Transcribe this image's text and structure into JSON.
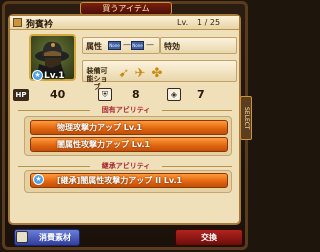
{
  "header": {
    "title": "買うアイテム"
  },
  "item": {
    "name": "狗賓衿",
    "lv_label": "Lv.",
    "lv_value": "1 / 25",
    "portrait_level": "Lv.1"
  },
  "attributes": {
    "attribute_label": "属性",
    "element_slots": [
      "None",
      "None"
    ],
    "special_label": "特効",
    "equip_label": "装備可能ショブ",
    "equip_icons": [
      "bow-icon",
      "wing-icon",
      "cross-icon"
    ]
  },
  "stats": {
    "hp_label": "HP",
    "hp_value": "40",
    "defense_value": "8",
    "defense_icon": "shield-icon",
    "magic_value": "7",
    "magic_icon": "diamond-icon"
  },
  "unique_abilities": {
    "header": "固有アビリティ",
    "items": [
      "物理攻撃力アップ Lv.1",
      "闇属性攻撃力アップ Lv.1"
    ]
  },
  "inherited_abilities": {
    "header": "継承アビリティ",
    "items": [
      "[継承]闇属性攻撃力アップ II Lv.1"
    ]
  },
  "side_tab": {
    "label": "SELECT"
  },
  "buttons": {
    "materials": "消費素材",
    "exchange": "交換"
  },
  "colors": {
    "ability_orange": "#e06410",
    "panel_bg": "#efe0b9",
    "exchange_red": "#b4231e",
    "materials_blue": "#2e3f9c"
  }
}
